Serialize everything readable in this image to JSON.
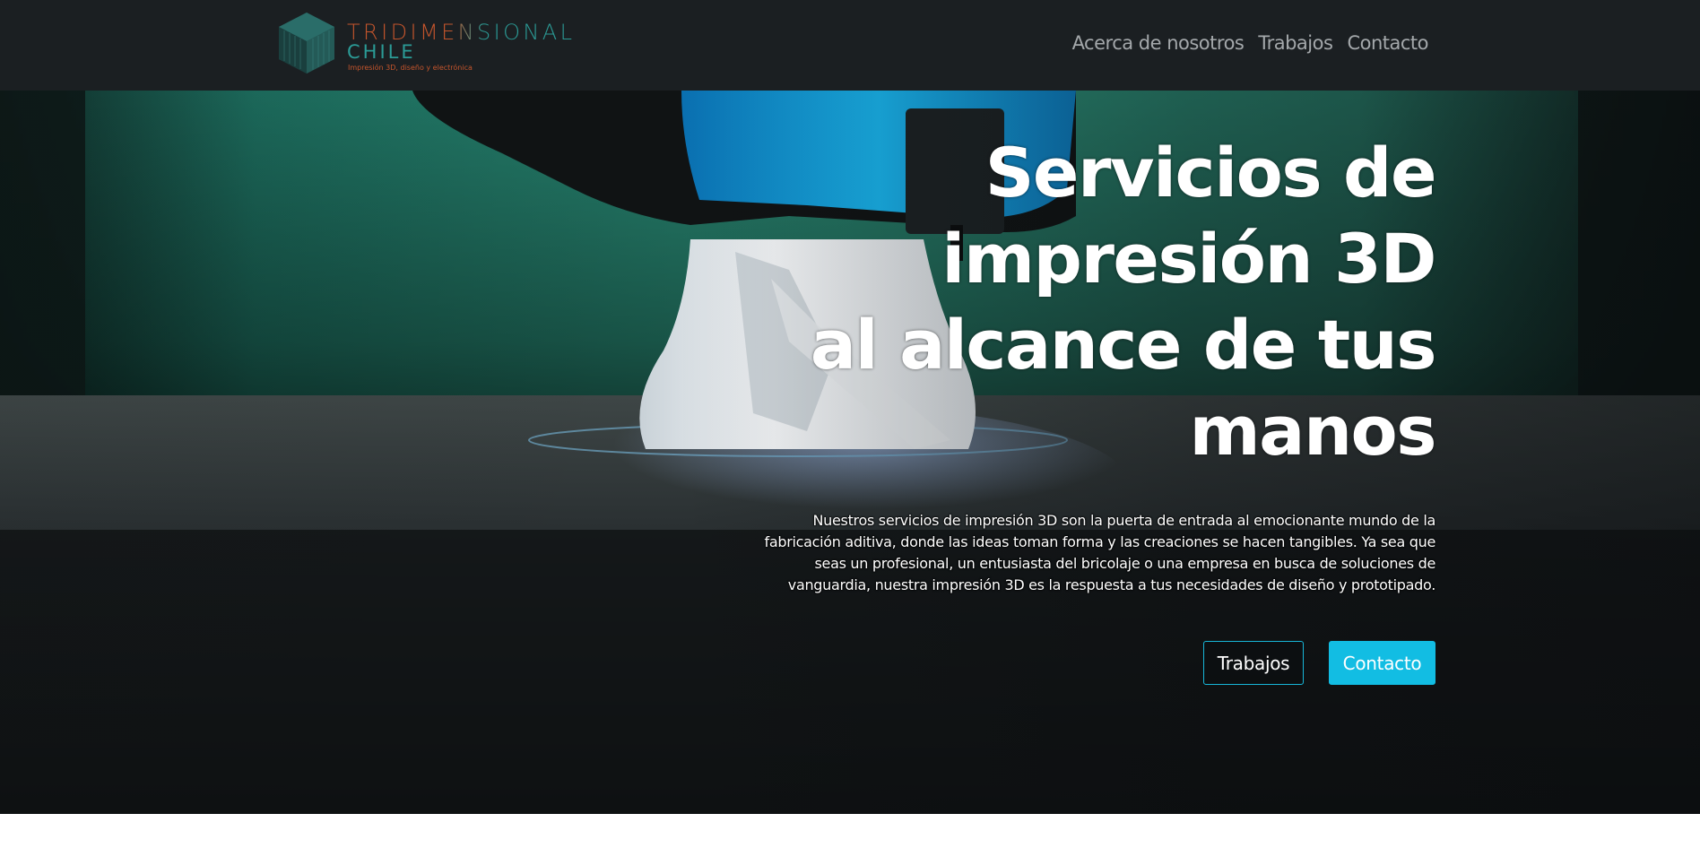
{
  "brand": {
    "line1": "TRIDIMENSIONAL",
    "line2": "CHILE",
    "tagline": "Impresión 3D, diseño y electrónica",
    "colors": {
      "orange": "#c5552c",
      "teal": "#2b9b96"
    }
  },
  "nav": {
    "items": [
      {
        "label": "Acerca de nosotros"
      },
      {
        "label": "Trabajos"
      },
      {
        "label": "Contacto"
      }
    ]
  },
  "hero": {
    "title_lines": [
      "Servicios de",
      "impresión 3D",
      "al alcance de tus",
      "manos"
    ],
    "description": "Nuestros servicios de impresión 3D son la puerta de entrada al emocionante mundo de la fabricación aditiva, donde las ideas toman forma y las creaciones se hacen tangibles. Ya sea que seas un profesional, un entusiasta del bricolaje o una empresa en busca de soluciones de vanguardia, nuestra impresión 3D es la respuesta a tus necesidades de diseño y prototipado.",
    "buttons": {
      "secondary": "Trabajos",
      "primary": "Contacto"
    },
    "accent_color": "#12bde3",
    "background_image": "3d-printer-printing-white-object"
  }
}
